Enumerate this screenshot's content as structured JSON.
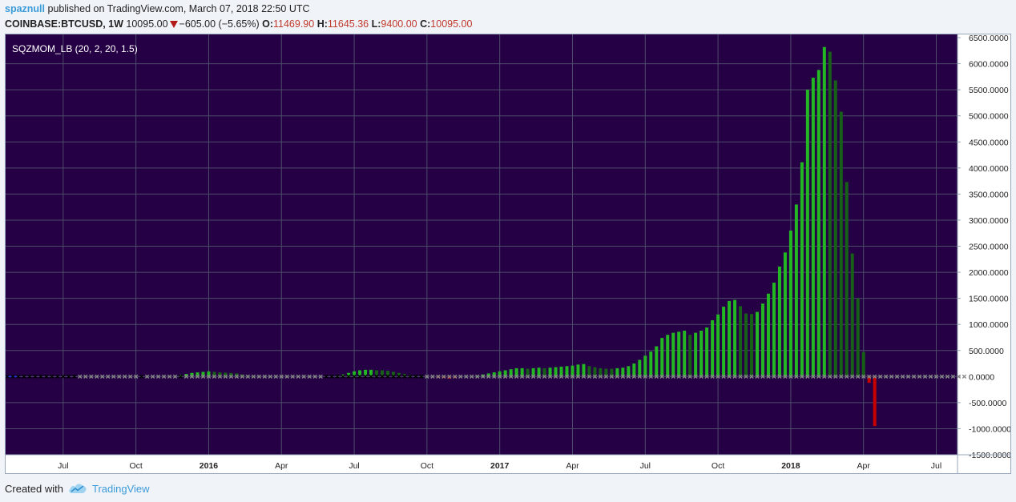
{
  "header": {
    "author": "spaznull",
    "published": "published on TradingView.com, March 07, 2018 22:50 UTC",
    "symbol": "COINBASE:BTCUSD, 1W",
    "last": "10095.00",
    "change": "−605.00 (−5.65%)",
    "o_label": "O:",
    "o": "11469.90",
    "h_label": "H:",
    "h": "11645.36",
    "l_label": "L:",
    "l": "9400.00",
    "c_label": "C:",
    "c": "10095.00"
  },
  "footer": {
    "created_with": "Created with",
    "brand": "TradingView"
  },
  "colors": {
    "panel_bg": "#250044",
    "grid": "#4d4d6b",
    "bar_bright": "#23b723",
    "bar_dark": "#176017",
    "bar_red": "#c80000",
    "dot_gray": "#888888",
    "dot_black": "#000000",
    "axis_text": "#222222"
  },
  "chart_data": {
    "type": "bar",
    "indicator_label": "SQZMOM_LB (20, 2, 20, 1.5)",
    "ylim": [
      -1500,
      6500
    ],
    "y_ticks": [
      6500,
      6000,
      5500,
      5000,
      4500,
      4000,
      3500,
      3000,
      2500,
      2000,
      1500,
      1000,
      500,
      0,
      -500,
      -1000,
      -1500
    ],
    "y_tick_labels": [
      "6500.0000",
      "6000.0000",
      "5500.0000",
      "5000.0000",
      "4500.0000",
      "4000.0000",
      "3500.0000",
      "3000.0000",
      "2500.0000",
      "2000.0000",
      "1500.0000",
      "1000.0000",
      "500.0000",
      "0.0000",
      "-500.0000",
      "-1000.0000",
      "-1500.0000"
    ],
    "x_ticks": [
      {
        "label": "Jul",
        "bold": false
      },
      {
        "label": "Oct",
        "bold": false
      },
      {
        "label": "2016",
        "bold": true
      },
      {
        "label": "Apr",
        "bold": false
      },
      {
        "label": "Jul",
        "bold": false
      },
      {
        "label": "Oct",
        "bold": false
      },
      {
        "label": "2017",
        "bold": true
      },
      {
        "label": "Apr",
        "bold": false
      },
      {
        "label": "Jul",
        "bold": false
      },
      {
        "label": "Oct",
        "bold": false
      },
      {
        "label": "2018",
        "bold": true
      },
      {
        "label": "Apr",
        "bold": false
      },
      {
        "label": "Jul",
        "bold": false
      }
    ],
    "x_unit": "week",
    "x_range": [
      0,
      163
    ],
    "x_tick_positions": [
      10,
      23,
      36,
      49,
      62,
      75,
      88,
      101,
      114,
      127,
      140,
      153,
      166
    ],
    "values": [
      0,
      0,
      0,
      0,
      0,
      0,
      0,
      0,
      0,
      0,
      0,
      0,
      0,
      0,
      0,
      0,
      0,
      0,
      0,
      0,
      0,
      0,
      0,
      0,
      0,
      0,
      0,
      0,
      0,
      0,
      0,
      30,
      50,
      70,
      80,
      90,
      100,
      90,
      80,
      75,
      70,
      60,
      40,
      20,
      10,
      0,
      0,
      0,
      0,
      0,
      0,
      0,
      0,
      0,
      0,
      0,
      0,
      0,
      0,
      20,
      40,
      70,
      100,
      120,
      130,
      130,
      120,
      120,
      110,
      90,
      70,
      50,
      30,
      20,
      10,
      0,
      0,
      -20,
      -30,
      -40,
      -30,
      0,
      0,
      0,
      20,
      40,
      60,
      80,
      100,
      120,
      140,
      160,
      160,
      150,
      160,
      170,
      160,
      170,
      180,
      190,
      200,
      210,
      230,
      240,
      200,
      180,
      160,
      150,
      150,
      160,
      170,
      200,
      250,
      320,
      400,
      480,
      580,
      740,
      800,
      840,
      860,
      880,
      800,
      840,
      880,
      940,
      1080,
      1190,
      1340,
      1450,
      1470,
      1350,
      1210,
      1200,
      1240,
      1400,
      1590,
      1800,
      2110,
      2380,
      2800,
      3300,
      4110,
      5500,
      5730,
      5880,
      6320,
      6230,
      5680,
      5080,
      3730,
      2360,
      1500,
      470,
      -120,
      -950
    ],
    "value_colors": [
      "bright",
      "bright",
      "bright",
      "bright",
      "bright",
      "bright",
      "bright",
      "bright",
      "bright",
      "bright",
      "bright",
      "bright",
      "bright",
      "bright",
      "bright",
      "bright",
      "bright",
      "bright",
      "bright",
      "bright",
      "bright",
      "bright",
      "bright",
      "bright",
      "bright",
      "bright",
      "bright",
      "bright",
      "bright",
      "bright",
      "bright",
      "bright",
      "bright",
      "bright",
      "bright",
      "bright",
      "bright",
      "dark",
      "dark",
      "dark",
      "dark",
      "dark",
      "dark",
      "dark",
      "dark",
      "dark",
      "dark",
      "dark",
      "dark",
      "dark",
      "dark",
      "dark",
      "dark",
      "dark",
      "dark",
      "dark",
      "dark",
      "dark",
      "dark",
      "bright",
      "bright",
      "bright",
      "bright",
      "bright",
      "bright",
      "bright",
      "dark",
      "dark",
      "dark",
      "dark",
      "dark",
      "dark",
      "dark",
      "dark",
      "dark",
      "dark",
      "dark",
      "red",
      "red",
      "red",
      "red",
      "bright",
      "bright",
      "bright",
      "bright",
      "bright",
      "bright",
      "bright",
      "bright",
      "bright",
      "bright",
      "bright",
      "bright",
      "dark",
      "bright",
      "bright",
      "dark",
      "bright",
      "bright",
      "bright",
      "bright",
      "bright",
      "bright",
      "bright",
      "dark",
      "dark",
      "dark",
      "dark",
      "dark",
      "bright",
      "bright",
      "bright",
      "bright",
      "bright",
      "bright",
      "bright",
      "bright",
      "bright",
      "bright",
      "bright",
      "bright",
      "bright",
      "dark",
      "bright",
      "bright",
      "bright",
      "bright",
      "bright",
      "bright",
      "bright",
      "bright",
      "dark",
      "dark",
      "dark",
      "bright",
      "bright",
      "bright",
      "bright",
      "bright",
      "bright",
      "bright",
      "bright",
      "bright",
      "bright",
      "bright",
      "bright",
      "bright",
      "dark",
      "dark",
      "dark",
      "dark",
      "dark",
      "dark",
      "dark",
      "red",
      "red"
    ],
    "squeeze_dots": [
      "black",
      "black",
      "black",
      "black",
      "black",
      "black",
      "black",
      "black",
      "black",
      "black",
      "black",
      "black",
      "black",
      "gray",
      "gray",
      "gray",
      "gray",
      "gray",
      "gray",
      "gray",
      "gray",
      "gray",
      "gray",
      "gray",
      "black",
      "gray",
      "gray",
      "gray",
      "gray",
      "gray",
      "gray",
      "black",
      "gray",
      "gray",
      "gray",
      "gray",
      "gray",
      "gray",
      "gray",
      "gray",
      "gray",
      "gray",
      "gray",
      "gray",
      "gray",
      "gray",
      "gray",
      "gray",
      "gray",
      "gray",
      "gray",
      "gray",
      "gray",
      "gray",
      "gray",
      "gray",
      "gray",
      "black",
      "black",
      "black",
      "black",
      "black",
      "black",
      "black",
      "black",
      "black",
      "black",
      "black",
      "black",
      "black",
      "black",
      "black",
      "black",
      "black",
      "black",
      "gray",
      "gray",
      "gray",
      "gray",
      "gray",
      "gray",
      "gray",
      "gray",
      "gray",
      "gray",
      "gray",
      "gray",
      "gray",
      "gray",
      "gray",
      "gray",
      "gray",
      "gray",
      "gray",
      "gray",
      "gray",
      "gray",
      "gray",
      "gray",
      "gray",
      "gray",
      "gray",
      "gray",
      "gray",
      "gray",
      "gray",
      "gray",
      "gray",
      "gray",
      "gray",
      "gray",
      "gray",
      "gray",
      "gray",
      "gray",
      "gray",
      "gray",
      "gray",
      "gray",
      "gray",
      "gray",
      "gray",
      "gray",
      "gray",
      "gray",
      "gray",
      "gray",
      "gray",
      "gray",
      "gray",
      "gray",
      "gray",
      "gray",
      "gray",
      "gray",
      "gray",
      "gray",
      "gray",
      "gray",
      "gray",
      "gray",
      "gray",
      "gray",
      "gray",
      "gray",
      "gray",
      "gray",
      "gray",
      "gray",
      "gray",
      "gray",
      "gray",
      "gray",
      "gray",
      "gray",
      "gray",
      "gray",
      "gray",
      "gray",
      "gray",
      "gray",
      "gray",
      "gray",
      "gray",
      "gray",
      "gray",
      "gray",
      "gray",
      "gray",
      "gray",
      "gray",
      "gray"
    ],
    "grid": true,
    "y_axis_position": "right"
  }
}
